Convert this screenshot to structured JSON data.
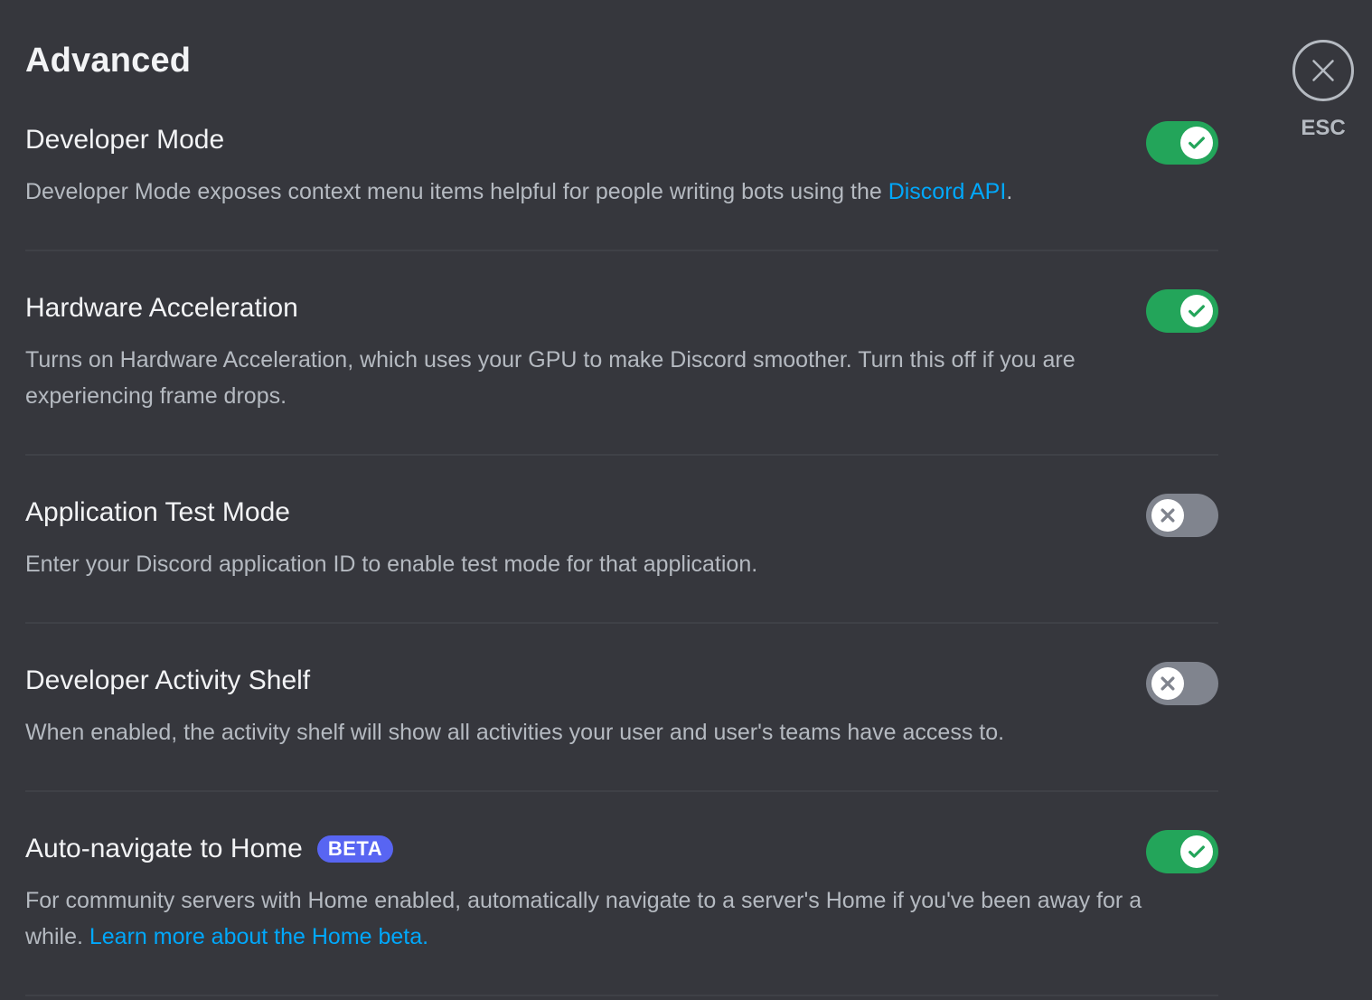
{
  "page": {
    "title": "Advanced"
  },
  "close": {
    "label": "ESC"
  },
  "colors": {
    "toggle_on": "#23a55a",
    "toggle_off": "#80848e",
    "link": "#00a8fc",
    "badge": "#5865f2"
  },
  "settings": [
    {
      "title": "Developer Mode",
      "enabled": true,
      "desc_before": "Developer Mode exposes context menu items helpful for people writing bots using the ",
      "link": "Discord API",
      "desc_after": "."
    },
    {
      "title": "Hardware Acceleration",
      "enabled": true,
      "desc": "Turns on Hardware Acceleration, which uses your GPU to make Discord smoother. Turn this off if you are experiencing frame drops."
    },
    {
      "title": "Application Test Mode",
      "enabled": false,
      "desc": "Enter your Discord application ID to enable test mode for that application."
    },
    {
      "title": "Developer Activity Shelf",
      "enabled": false,
      "desc": "When enabled, the activity shelf will show all activities your user and user's teams have access to."
    },
    {
      "title": "Auto-navigate to Home",
      "badge": "BETA",
      "enabled": true,
      "desc_before": "For community servers with Home enabled, automatically navigate to a server's Home if you've been away for a while. ",
      "link": "Learn more about the Home beta.",
      "desc_after": ""
    }
  ]
}
